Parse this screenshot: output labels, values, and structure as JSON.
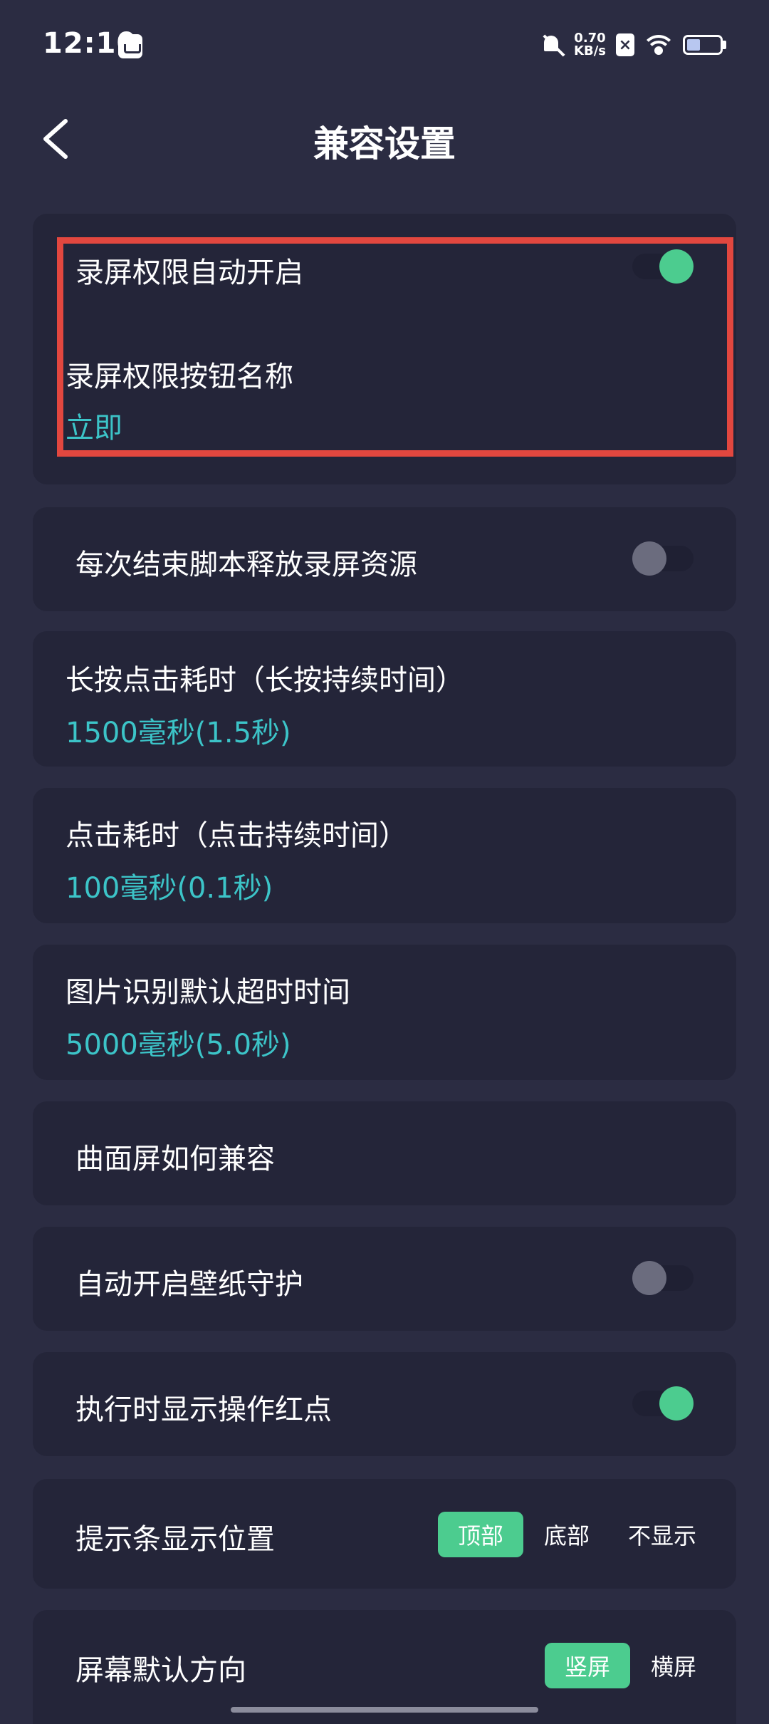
{
  "status_bar": {
    "time": "12:10",
    "net_speed_value": "0.70",
    "net_speed_unit": "KB/s",
    "icons": [
      "app-notification-icon",
      "mute-icon",
      "sim-x-icon",
      "wifi-icon",
      "battery-icon"
    ],
    "battery_level": 0.36
  },
  "header": {
    "title": "兼容设置",
    "back_icon": "chevron-left"
  },
  "settings": {
    "auto_record_permission": {
      "label": "录屏权限自动开启",
      "enabled": true
    },
    "record_button_name": {
      "label": "录屏权限按钮名称",
      "value": "立即"
    },
    "release_record_resource": {
      "label": "每次结束脚本释放录屏资源",
      "enabled": false
    },
    "long_press_duration": {
      "label": "长按点击耗时（长按持续时间）",
      "value": "1500毫秒(1.5秒)"
    },
    "tap_duration": {
      "label": "点击耗时（点击持续时间）",
      "value": "100毫秒(0.1秒)"
    },
    "image_recognition_timeout": {
      "label": "图片识别默认超时时间",
      "value": "5000毫秒(5.0秒)"
    },
    "curved_screen": {
      "label": "曲面屏如何兼容"
    },
    "wallpaper_guard": {
      "label": "自动开启壁纸守护",
      "enabled": false
    },
    "show_red_dot": {
      "label": "执行时显示操作红点",
      "enabled": true
    },
    "tip_bar_position": {
      "label": "提示条显示位置",
      "options": [
        "顶部",
        "底部",
        "不显示"
      ],
      "selected": "顶部"
    },
    "screen_orientation": {
      "label": "屏幕默认方向",
      "options": [
        "竖屏",
        "横屏"
      ],
      "selected": "竖屏"
    }
  },
  "colors": {
    "background": "#2b2c42",
    "card": "#242539",
    "accent_green": "#4ccc8f",
    "value_cyan": "#3cc4c8",
    "highlight_red": "#e2473f"
  }
}
